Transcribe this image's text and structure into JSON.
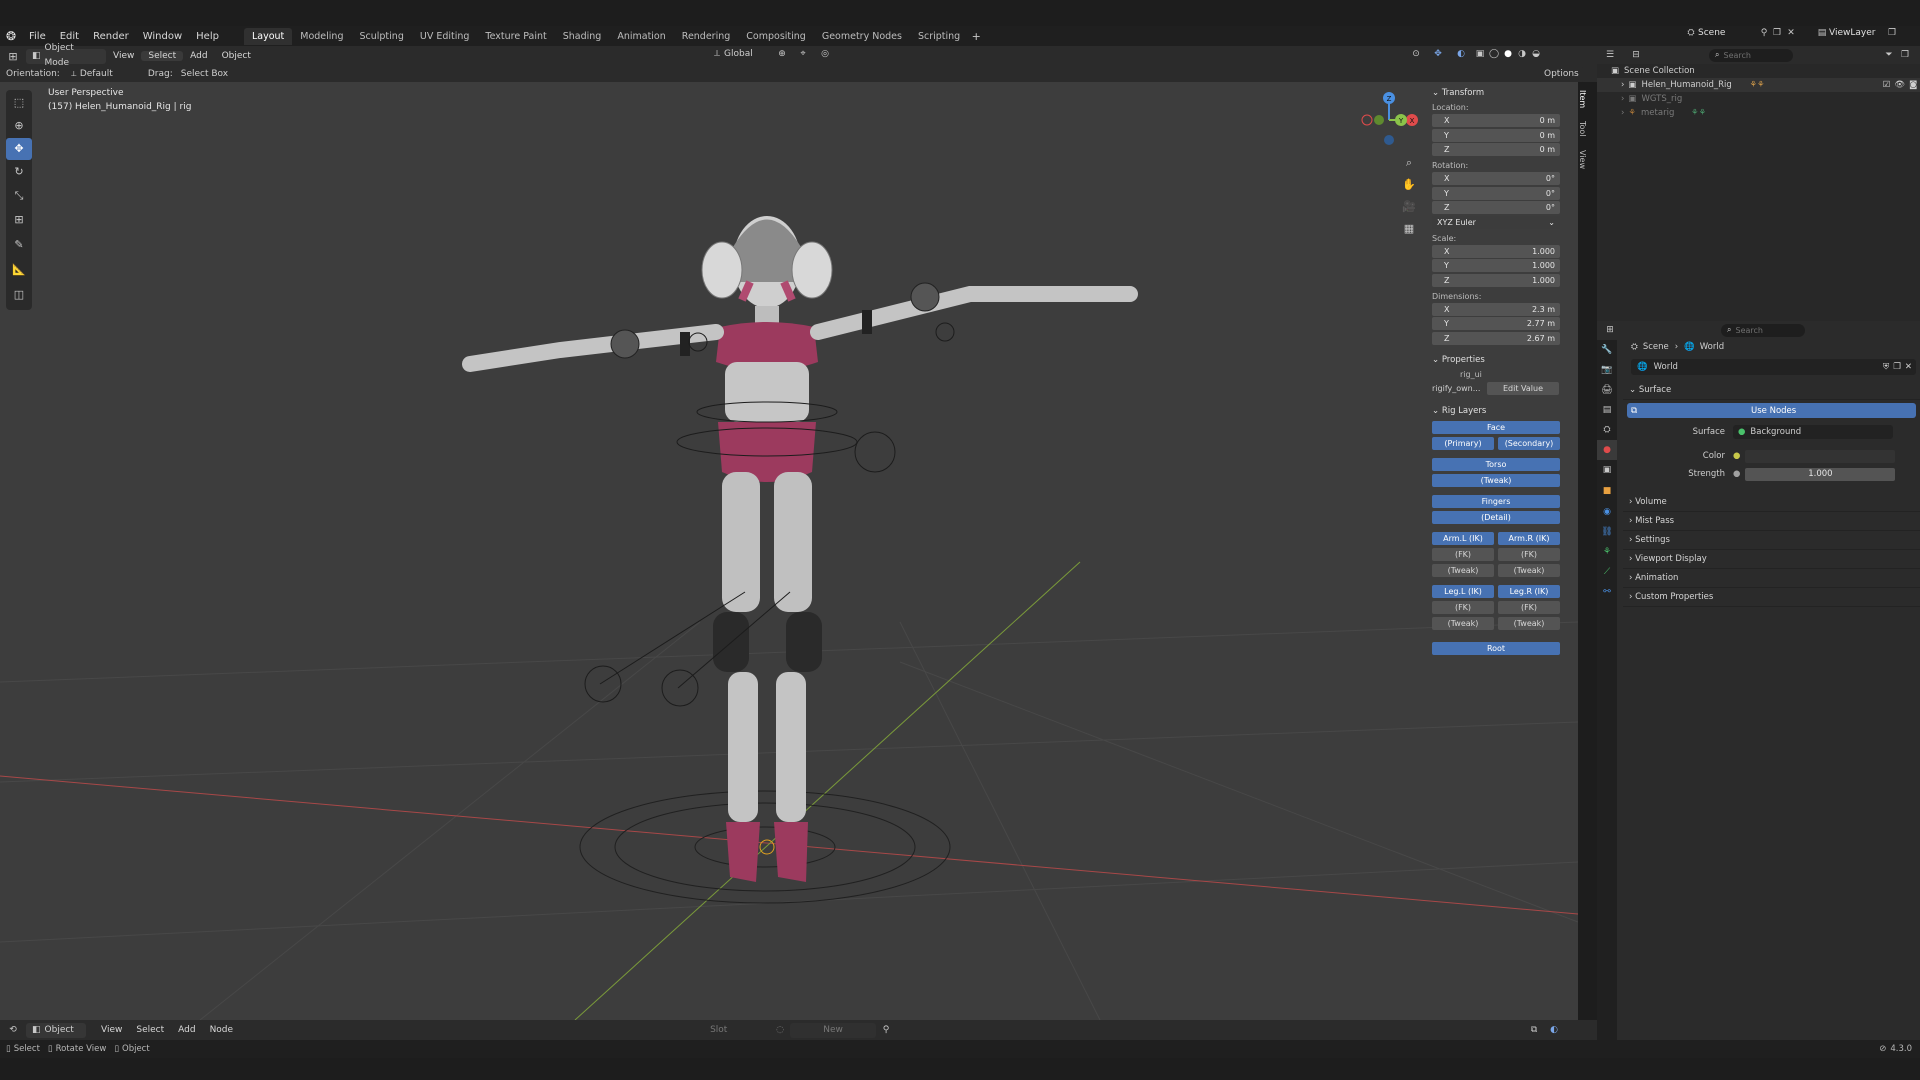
{
  "menubar": {
    "items": [
      "File",
      "Edit",
      "Render",
      "Window",
      "Help"
    ]
  },
  "workspaces": [
    "Layout",
    "Modeling",
    "Sculpting",
    "UV Editing",
    "Texture Paint",
    "Shading",
    "Animation",
    "Rendering",
    "Compositing",
    "Geometry Nodes",
    "Scripting"
  ],
  "scene": {
    "name": "Scene",
    "view_layer": "ViewLayer"
  },
  "viewport_header": {
    "mode": "Object Mode",
    "menus": [
      "View",
      "Select",
      "Add",
      "Object"
    ],
    "orientation_global": "Global",
    "options": "Options",
    "orientation_label": "Orientation:",
    "orientation_value": "Default",
    "drag_label": "Drag:",
    "drag_value": "Select Box"
  },
  "viewport": {
    "perspective": "User Perspective",
    "object_info": "(157) Helen_Humanoid_Rig | rig",
    "gizmo": {
      "z": "Z",
      "y": "Y",
      "x": "X"
    }
  },
  "npanel": {
    "tabs": [
      "Item",
      "Tool",
      "View"
    ],
    "transform": {
      "title": "Transform",
      "location_label": "Location:",
      "location": [
        {
          "axis": "X",
          "value": "0 m"
        },
        {
          "axis": "Y",
          "value": "0 m"
        },
        {
          "axis": "Z",
          "value": "0 m"
        }
      ],
      "rotation_label": "Rotation:",
      "rotation": [
        {
          "axis": "X",
          "value": "0°"
        },
        {
          "axis": "Y",
          "value": "0°"
        },
        {
          "axis": "Z",
          "value": "0°"
        }
      ],
      "rotation_mode": "XYZ Euler",
      "scale_label": "Scale:",
      "scale": [
        {
          "axis": "X",
          "value": "1.000"
        },
        {
          "axis": "Y",
          "value": "1.000"
        },
        {
          "axis": "Z",
          "value": "1.000"
        }
      ],
      "dimensions_label": "Dimensions:",
      "dimensions": [
        {
          "axis": "X",
          "value": "2.3 m"
        },
        {
          "axis": "Y",
          "value": "2.77 m"
        },
        {
          "axis": "Z",
          "value": "2.67 m"
        }
      ]
    },
    "properties": {
      "title": "Properties",
      "rig_ui": "rig_ui",
      "rigify_label": "rigify_own...",
      "edit_value": "Edit Value"
    },
    "rig_layers": {
      "title": "Rig Layers",
      "face": "Face",
      "primary": "(Primary)",
      "secondary": "(Secondary)",
      "torso": "Torso",
      "torso_tweak": "(Tweak)",
      "fingers": "Fingers",
      "detail": "(Detail)",
      "arm_l_ik": "Arm.L (IK)",
      "arm_r_ik": "Arm.R (IK)",
      "fk": "(FK)",
      "tweak": "(Tweak)",
      "leg_l_ik": "Leg.L (IK)",
      "leg_r_ik": "Leg.R (IK)",
      "root": "Root"
    }
  },
  "outliner": {
    "search_placeholder": "Search",
    "collection": "Scene Collection",
    "items": [
      "Helen_Humanoid_Rig",
      "WGTS_rig",
      "metarig"
    ]
  },
  "properties_editor": {
    "search_placeholder": "Search",
    "breadcrumb": {
      "scene": "Scene",
      "world": "World"
    },
    "world_name": "World",
    "surface_section": "Surface",
    "use_nodes": "Use Nodes",
    "surface_label": "Surface",
    "surface_value": "Background",
    "color_label": "Color",
    "strength_label": "Strength",
    "strength_value": "1.000",
    "sections": [
      "Volume",
      "Mist Pass",
      "Settings",
      "Viewport Display",
      "Animation",
      "Custom Properties"
    ]
  },
  "bottom_header": {
    "mode": "Object",
    "menus": [
      "View",
      "Select",
      "Add",
      "Node"
    ],
    "slot": "Slot",
    "new": "New"
  },
  "statusbar": {
    "select": "Select",
    "rotate": "Rotate View",
    "object": "Object",
    "version": "4.3.0"
  },
  "colors": {
    "accent": "#4772b3",
    "viewport_bg": "#3d3d3d",
    "x_axis": "#e04b4b",
    "y_axis": "#8bc34a",
    "z_axis": "#4a90e2"
  }
}
